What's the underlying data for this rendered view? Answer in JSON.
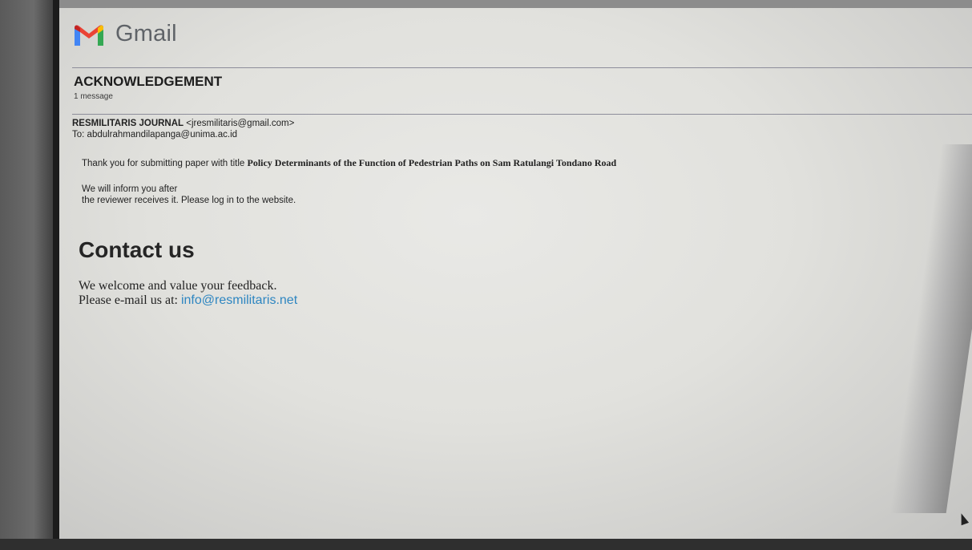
{
  "header": {
    "brand": "Gmail",
    "logo_icon": "gmail-m-icon",
    "logo_colors": [
      "#EA4335",
      "#4285F4",
      "#34A853",
      "#FBBC04",
      "#C5221F"
    ]
  },
  "thread": {
    "subject": "ACKNOWLEDGEMENT",
    "message_count": "1 message"
  },
  "message": {
    "sender_name": "RESMILITARIS JOURNAL",
    "sender_email": "<jresmilitaris@gmail.com>",
    "to_label": "To:",
    "to_address": "abdulrahmandilapanga@unima.ac.id",
    "body_intro": "Thank you for submitting paper  with title",
    "paper_title": "Policy Determinants of the Function of Pedestrian Paths on Sam Ratulangi Tondano Road",
    "body_line_a": "We will inform you after",
    "body_line_b": "the reviewer receives it. Please log in to the website."
  },
  "contact": {
    "heading": "Contact us",
    "line1": "We welcome and value your feedback.",
    "line2_prefix": "Please e-mail us at:",
    "email": "info@resmilitaris.net",
    "link_color": "#2e86c1"
  }
}
